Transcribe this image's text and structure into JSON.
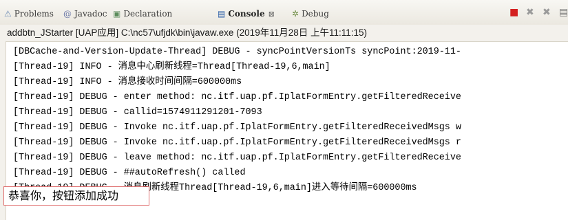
{
  "tabs": [
    {
      "label": "Problems",
      "icon": "problems-icon"
    },
    {
      "label": "Javadoc",
      "icon": "javadoc-icon"
    },
    {
      "label": "Declaration",
      "icon": "declaration-icon"
    },
    {
      "label": "Console",
      "icon": "console-icon",
      "active": true
    },
    {
      "label": "Debug",
      "icon": "debug-icon"
    }
  ],
  "toolbar": {
    "terminate_icon": "■",
    "remove_launch_icon": "✖",
    "remove_all_icon": "✖",
    "page_icon": "▤",
    "terminate_color": "#d42020"
  },
  "process_label": "addbtn_JStarter [UAP应用] C:\\nc57\\ufjdk\\bin\\javaw.exe (2019年11月28日 上午11:11:15)",
  "console_lines": [
    "[DBCache-and-Version-Update-Thread] DEBUG - syncPointVersionTs syncPoint:2019-11-",
    "[Thread-19] INFO - 消息中心刷新线程=Thread[Thread-19,6,main]",
    "[Thread-19] INFO - 消息接收时间间隔=600000ms",
    "[Thread-19] DEBUG - enter method: nc.itf.uap.pf.IplatFormEntry.getFilteredReceive",
    "[Thread-19] DEBUG - callid=1574911291201-7093",
    "[Thread-19] DEBUG - Invoke nc.itf.uap.pf.IplatFormEntry.getFilteredReceivedMsgs w",
    "[Thread-19] DEBUG - Invoke nc.itf.uap.pf.IplatFormEntry.getFilteredReceivedMsgs r",
    "[Thread-19] DEBUG - leave method: nc.itf.uap.pf.IplatFormEntry.getFilteredReceive",
    "[Thread-19] DEBUG - ##autoRefresh() called",
    "[Thread-19] DEBUG - 消息刷新线程Thread[Thread-19,6,main]进入等待间隔=600000ms"
  ],
  "toast_message": "恭喜你，按钮添加成功"
}
